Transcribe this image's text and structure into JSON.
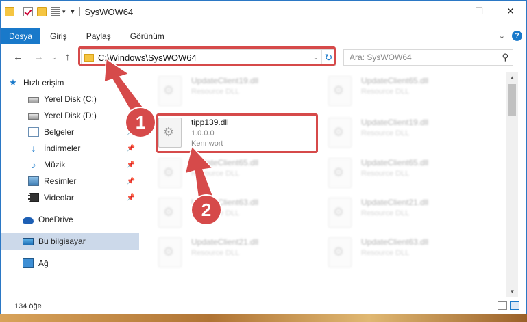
{
  "window": {
    "title": "SysWOW64"
  },
  "ribbon": {
    "tabs": [
      "Dosya",
      "Giriş",
      "Paylaş",
      "Görünüm"
    ]
  },
  "address": {
    "path": "C:\\Windows\\SysWOW64"
  },
  "search": {
    "placeholder": "Ara: SysWOW64"
  },
  "navigation": {
    "items": [
      {
        "label": "Hızlı erişim",
        "icon": "star-icon",
        "pinned": false
      },
      {
        "label": "Yerel Disk (C:)",
        "icon": "disk-icon",
        "pinned": true
      },
      {
        "label": "Yerel Disk (D:)",
        "icon": "disk-icon",
        "pinned": true
      },
      {
        "label": "Belgeler",
        "icon": "documents-icon",
        "pinned": true
      },
      {
        "label": "İndirmeler",
        "icon": "downloads-icon",
        "pinned": true
      },
      {
        "label": "Müzik",
        "icon": "music-icon",
        "pinned": true
      },
      {
        "label": "Resimler",
        "icon": "pictures-icon",
        "pinned": true
      },
      {
        "label": "Videolar",
        "icon": "videos-icon",
        "pinned": true
      },
      {
        "label": "OneDrive",
        "icon": "onedrive-icon",
        "pinned": false
      },
      {
        "label": "Bu bilgisayar",
        "icon": "this-pc-icon",
        "pinned": false,
        "selected": true
      },
      {
        "label": "Ağ",
        "icon": "network-icon",
        "pinned": false
      }
    ]
  },
  "files": {
    "left_column": [
      {
        "name": "UpdateClient19.dll",
        "line2": "Resource DLL",
        "line3": "",
        "blurred": true
      },
      {
        "name": "tipp139.dll",
        "line2": "1.0.0.0",
        "line3": "Kennwort",
        "blurred": false,
        "highlighted": true
      },
      {
        "name": "UpdateClient65.dll",
        "line2": "Resource DLL",
        "line3": "",
        "blurred": true
      },
      {
        "name": "UpdateClient63.dll",
        "line2": "Resource DLL",
        "line3": "",
        "blurred": true
      },
      {
        "name": "UpdateClient21.dll",
        "line2": "Resource DLL",
        "line3": "",
        "blurred": true
      }
    ],
    "right_column": [
      {
        "name": "UpdateClient65.dll",
        "line2": "Resource DLL",
        "line3": "",
        "blurred": true
      },
      {
        "name": "UpdateClient19.dll",
        "line2": "Resource DLL",
        "line3": "",
        "blurred": true
      },
      {
        "name": "UpdateClient65.dll",
        "line2": "Resource DLL",
        "line3": "",
        "blurred": true
      },
      {
        "name": "UpdateClient21.dll",
        "line2": "Resource DLL",
        "line3": "",
        "blurred": true
      },
      {
        "name": "UpdateClient63.dll",
        "line2": "Resource DLL",
        "line3": "",
        "blurred": true
      }
    ]
  },
  "status": {
    "item_count": "134 öğe"
  },
  "annotations": {
    "badge1": "1",
    "badge2": "2"
  },
  "colors": {
    "accent": "#1979ca",
    "annotation": "#d64a4a"
  }
}
